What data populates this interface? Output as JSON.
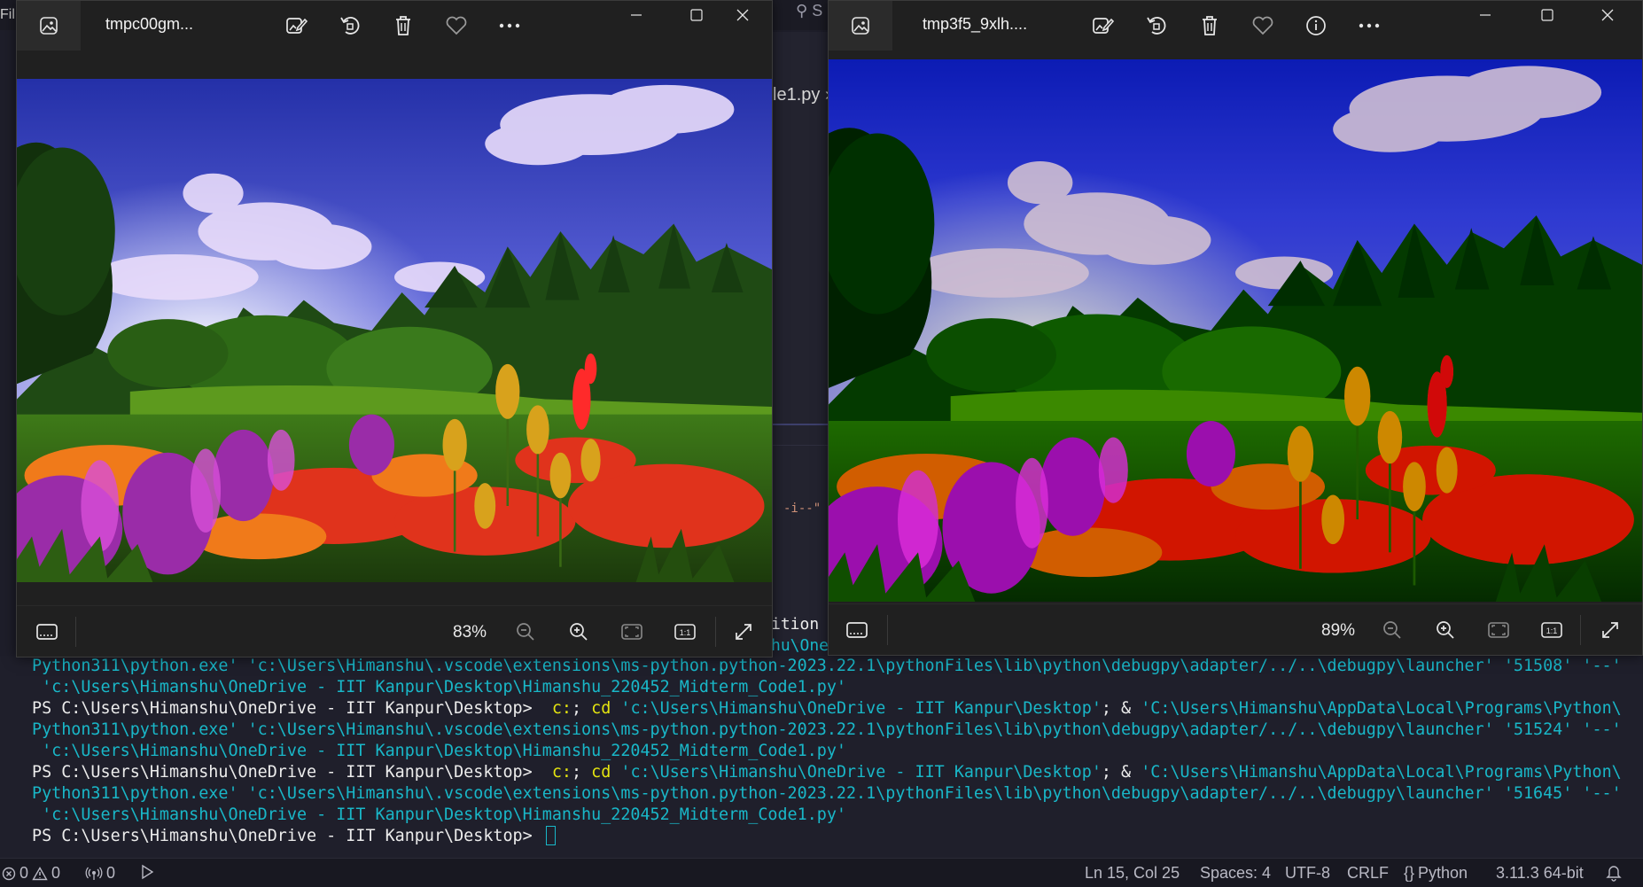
{
  "vscode": {
    "menu_fragment": "Fil",
    "search_fragment": "S",
    "tab_fragment": "le1.py",
    "editor_string_fragment": "-i--\"",
    "editor_text_fragment": "ition",
    "terminal_text_fragment": "hu\\One"
  },
  "viewer_left": {
    "filename": "tmpc00gm...",
    "zoom": "83%",
    "icons": [
      "photos-app-icon",
      "edit-image-icon",
      "rotate-icon",
      "delete-icon",
      "favorite-icon",
      "more-icon"
    ],
    "window_controls": [
      "minimize",
      "maximize",
      "close"
    ]
  },
  "viewer_right": {
    "filename": "tmp3f5_9xlh....",
    "zoom": "89%",
    "icons": [
      "photos-app-icon",
      "edit-image-icon",
      "rotate-icon",
      "delete-icon",
      "favorite-icon",
      "info-icon",
      "more-icon"
    ],
    "window_controls": [
      "minimize",
      "maximize",
      "close"
    ]
  },
  "terminal": {
    "lines": [
      {
        "segments": [
          {
            "text": "Python311\\python.exe' 'c:\\Users\\Himanshu\\.vscode\\extensions\\ms-python.python-2023.22.1\\pythonFiles\\lib\\python\\debugpy\\adapter/../..\\debugpy\\launcher' '51508' '--'",
            "color": "cyan"
          }
        ]
      },
      {
        "segments": [
          {
            "text": " 'c:\\Users\\Himanshu\\OneDrive - IIT Kanpur\\Desktop\\Himanshu_220452_Midterm_Code1.py'",
            "color": "cyan"
          }
        ]
      },
      {
        "segments": [
          {
            "text": "PS C:\\Users\\Himanshu\\OneDrive - IIT Kanpur\\Desktop>  ",
            "color": "white"
          },
          {
            "text": "c:",
            "color": "yellow"
          },
          {
            "text": "; ",
            "color": "white"
          },
          {
            "text": "cd",
            "color": "yellow"
          },
          {
            "text": " 'c:\\Users\\Himanshu\\OneDrive - IIT Kanpur\\Desktop'",
            "color": "cyan"
          },
          {
            "text": "; & ",
            "color": "white"
          },
          {
            "text": "'C:\\Users\\Himanshu\\AppData\\Local\\Programs\\Python\\",
            "color": "cyan"
          }
        ]
      },
      {
        "segments": [
          {
            "text": "Python311\\python.exe' 'c:\\Users\\Himanshu\\.vscode\\extensions\\ms-python.python-2023.22.1\\pythonFiles\\lib\\python\\debugpy\\adapter/../..\\debugpy\\launcher' '51524' '--'",
            "color": "cyan"
          }
        ]
      },
      {
        "segments": [
          {
            "text": " 'c:\\Users\\Himanshu\\OneDrive - IIT Kanpur\\Desktop\\Himanshu_220452_Midterm_Code1.py'",
            "color": "cyan"
          }
        ]
      },
      {
        "segments": [
          {
            "text": "PS C:\\Users\\Himanshu\\OneDrive - IIT Kanpur\\Desktop>  ",
            "color": "white"
          },
          {
            "text": "c:",
            "color": "yellow"
          },
          {
            "text": "; ",
            "color": "white"
          },
          {
            "text": "cd",
            "color": "yellow"
          },
          {
            "text": " 'c:\\Users\\Himanshu\\OneDrive - IIT Kanpur\\Desktop'",
            "color": "cyan"
          },
          {
            "text": "; & ",
            "color": "white"
          },
          {
            "text": "'C:\\Users\\Himanshu\\AppData\\Local\\Programs\\Python\\",
            "color": "cyan"
          }
        ]
      },
      {
        "segments": [
          {
            "text": "Python311\\python.exe' 'c:\\Users\\Himanshu\\.vscode\\extensions\\ms-python.python-2023.22.1\\pythonFiles\\lib\\python\\debugpy\\adapter/../..\\debugpy\\launcher' '51645' '--'",
            "color": "cyan"
          }
        ]
      },
      {
        "segments": [
          {
            "text": " 'c:\\Users\\Himanshu\\OneDrive - IIT Kanpur\\Desktop\\Himanshu_220452_Midterm_Code1.py'",
            "color": "cyan"
          }
        ]
      },
      {
        "segments": [
          {
            "text": "PS C:\\Users\\Himanshu\\OneDrive - IIT Kanpur\\Desktop> ",
            "color": "white"
          }
        ],
        "cursor": true
      }
    ]
  },
  "statusbar": {
    "errors": "0",
    "warnings": "0",
    "ports": "0",
    "position": "Ln 15, Col 25",
    "spaces": "Spaces: 4",
    "encoding": "UTF-8",
    "eol": "CRLF",
    "language": "Python",
    "interpreter": "3.11.3 64-bit"
  },
  "colors": {
    "cyan": "#19b7c8",
    "yellow": "#e5e510",
    "white": "#ececec"
  }
}
